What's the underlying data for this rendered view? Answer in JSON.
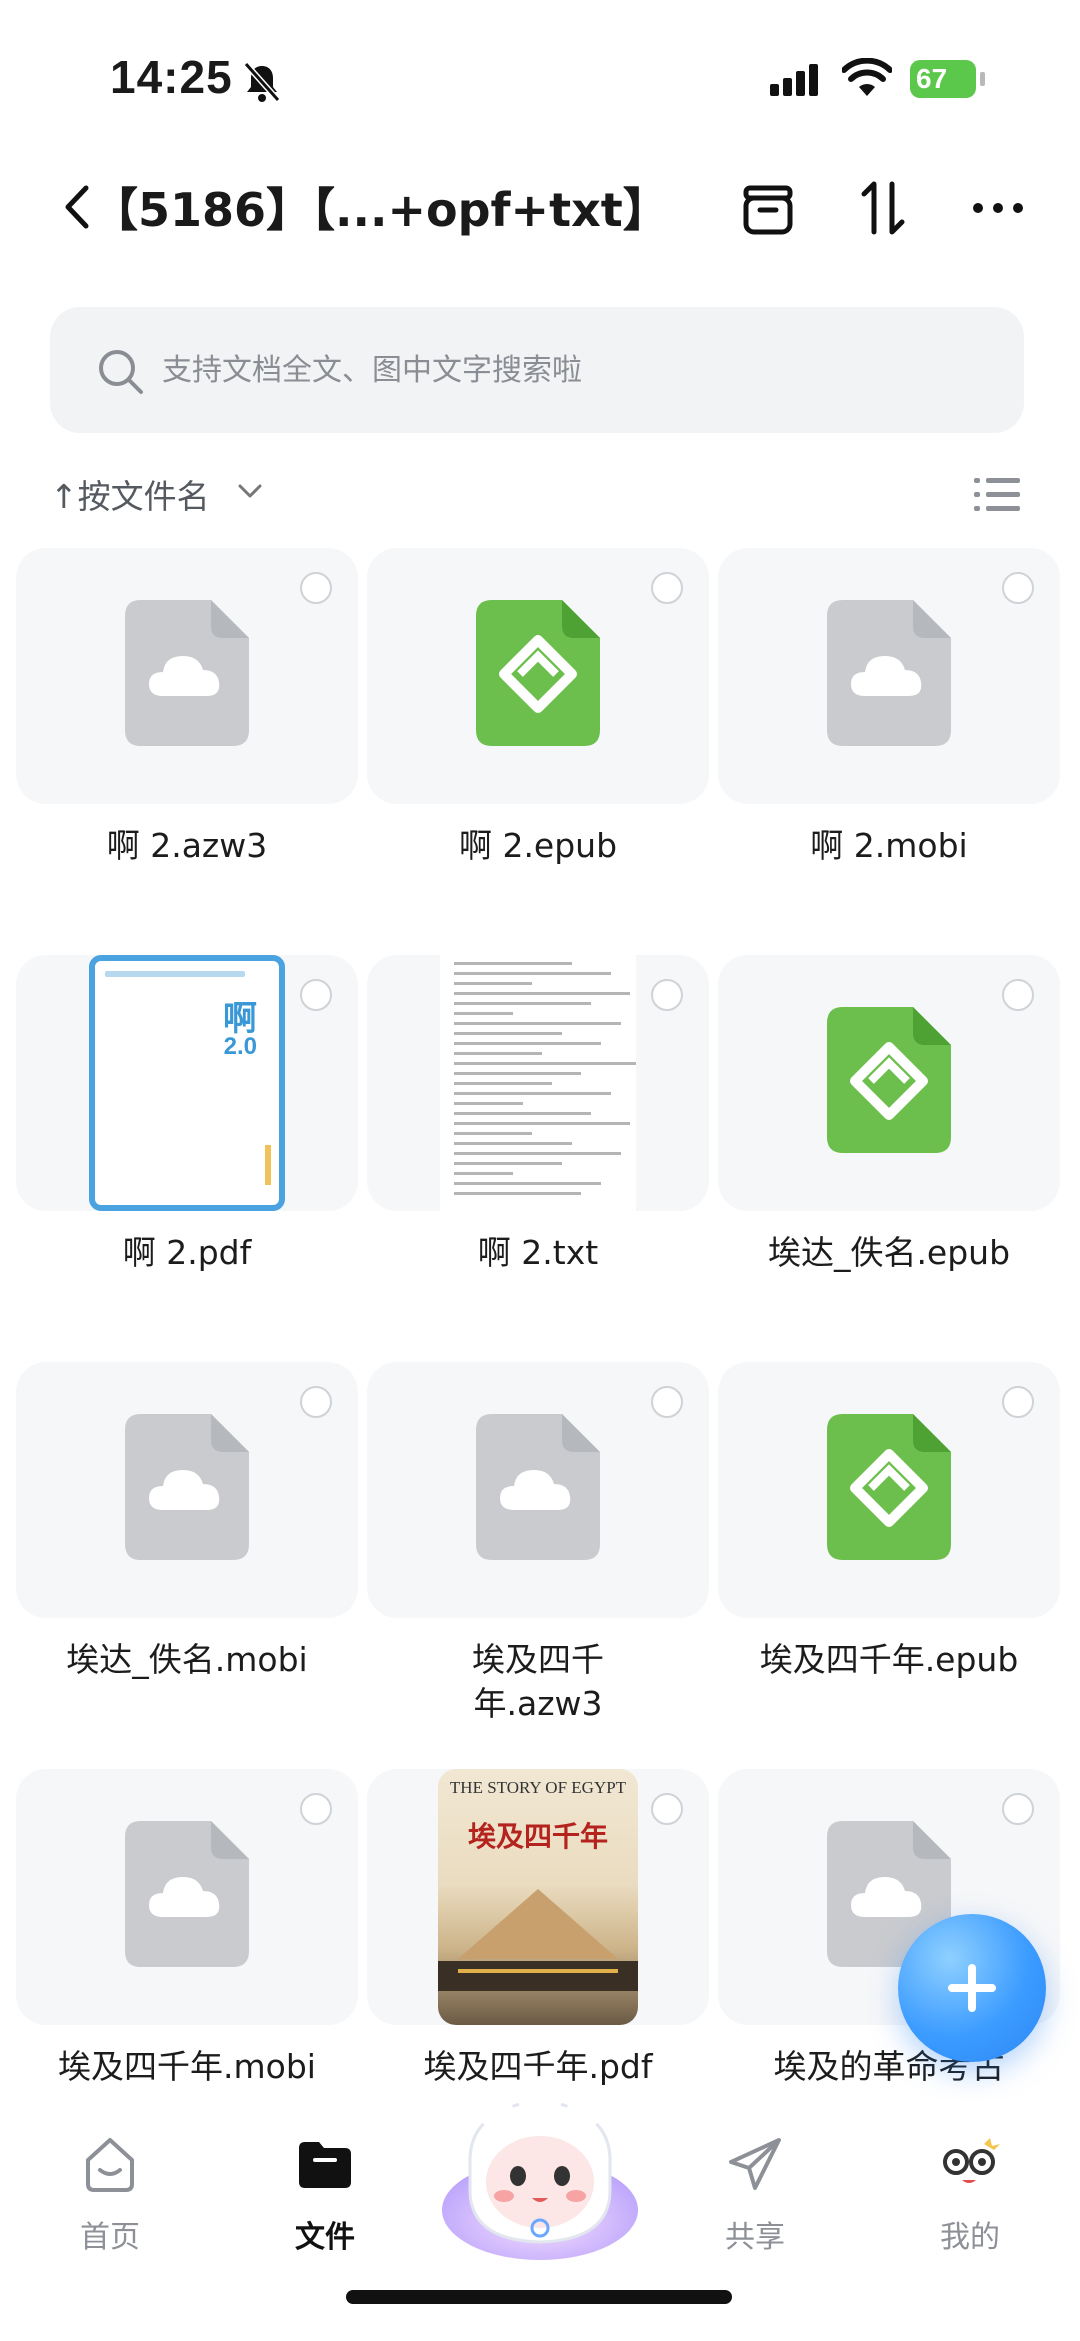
{
  "status_bar": {
    "time": "14:25",
    "battery": "67"
  },
  "header": {
    "title": "【5186】【...+opf+txt】"
  },
  "search": {
    "placeholder": "支持文档全文、图中文字搜索啦"
  },
  "sort": {
    "label": "↑按文件名"
  },
  "files": [
    {
      "name": "啊 2.azw3",
      "type": "cloud"
    },
    {
      "name": "啊 2.epub",
      "type": "epub"
    },
    {
      "name": "啊 2.mobi",
      "type": "cloud"
    },
    {
      "name": "啊 2.pdf",
      "type": "pdf-cover",
      "cover_text": "啊",
      "cover_version": "2.0"
    },
    {
      "name": "啊 2.txt",
      "type": "txt-cover"
    },
    {
      "name": "埃达_佚名.epub",
      "type": "epub"
    },
    {
      "name": "埃达_佚名.mobi",
      "type": "cloud"
    },
    {
      "name": "埃及四千年.azw3",
      "name_line1": "埃及四千",
      "name_line2": "年.azw3",
      "type": "cloud"
    },
    {
      "name": "埃及四千年.epub",
      "type": "epub"
    },
    {
      "name": "埃及四千年.mobi",
      "type": "cloud"
    },
    {
      "name": "埃及四千年.pdf",
      "type": "book-cover",
      "cover_title_en": "THE STORY OF EGYPT",
      "cover_title_cn": "埃及四千年"
    },
    {
      "name": "埃及的革命考古",
      "type": "cloud"
    }
  ],
  "nav": {
    "items": [
      {
        "label": "首页"
      },
      {
        "label": "文件"
      },
      {
        "label": "共享"
      },
      {
        "label": "我的"
      }
    ]
  },
  "colors": {
    "accent": "#3c9cff",
    "epub_green": "#6cbf4c",
    "cloud_gray": "#c9cbcf"
  }
}
